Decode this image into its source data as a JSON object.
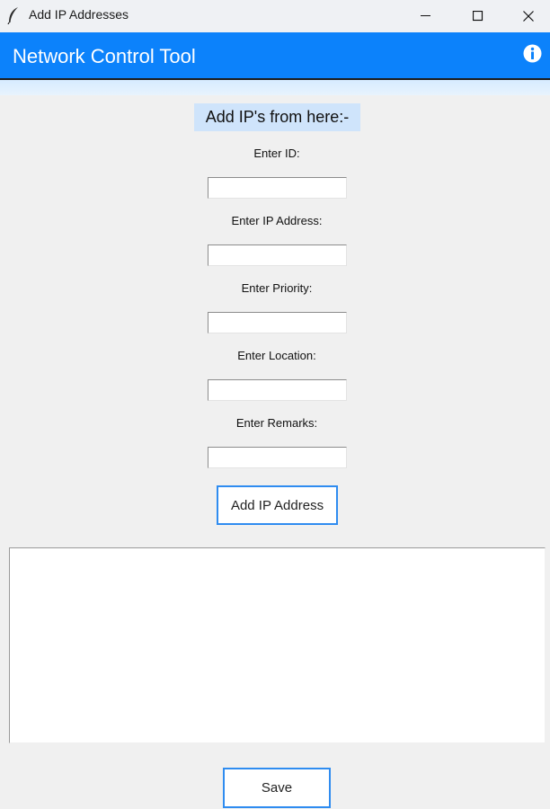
{
  "window": {
    "title": "Add IP Addresses",
    "icon": "feather-icon",
    "controls": [
      "minimize-icon",
      "maximize-icon",
      "close-icon"
    ]
  },
  "header": {
    "title": "Network Control Tool",
    "icon": "info-icon",
    "background": "#0c82fb"
  },
  "form": {
    "heading": "Add IP's from here:-",
    "fields": [
      {
        "label": "Enter ID:",
        "value": ""
      },
      {
        "label": "Enter IP Address:",
        "value": ""
      },
      {
        "label": "Enter Priority:",
        "value": ""
      },
      {
        "label": "Enter Location:",
        "value": ""
      },
      {
        "label": "Enter Remarks:",
        "value": ""
      }
    ],
    "add_button": "Add IP Address"
  },
  "output": {
    "value": ""
  },
  "save_button": "Save",
  "colors": {
    "accent": "#0c82fb",
    "button_border": "#2f8cf0",
    "heading_bg": "#cfe4fb"
  }
}
